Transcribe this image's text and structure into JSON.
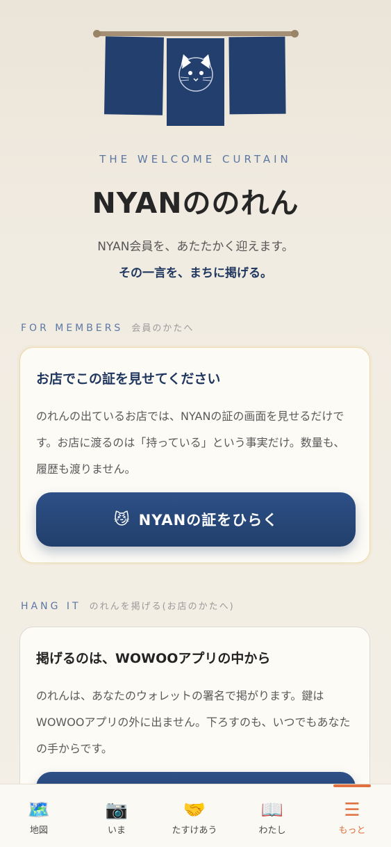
{
  "header": {
    "tagline": "THE WELCOME CURTAIN",
    "title": "NYANののれん",
    "subtitle": "NYAN会員を、あたたかく迎えます。",
    "subtitle_emphasis": "その一言を、まちに掲げる。"
  },
  "members_section": {
    "label_en": "FOR MEMBERS",
    "label_jp": "会員のかたへ",
    "card_title": "お店でこの証を見せてください",
    "card_body": "のれんの出ているお店では、NYANの証の画面を見せるだけです。お店に渡るのは「持っている」という事実だけ。数量も、履歴も渡りません。",
    "button_icon": "😼",
    "button_label": "NYANの証をひらく"
  },
  "hang_section": {
    "label_en": "HANG IT",
    "label_jp": "のれんを掲げる(お店のかたへ)",
    "card_title": "掲げるのは、WOWOOアプリの中から",
    "card_body": "のれんは、あなたのウォレットの署名で掲がります。鍵はWOWOOアプリの外に出ません。下ろすのも、いつでもあなたの手からです。"
  },
  "tabbar": {
    "items": [
      {
        "icon": "🗺️",
        "icon_name": "map-icon",
        "label": "地図"
      },
      {
        "icon": "📷",
        "icon_name": "camera-icon",
        "label": "いま"
      },
      {
        "icon": "🤝",
        "icon_name": "handshake-icon",
        "label": "たすけあう"
      },
      {
        "icon": "📖",
        "icon_name": "book-icon",
        "label": "わたし"
      },
      {
        "icon": "☰",
        "icon_name": "menu-icon",
        "label": "もっと"
      }
    ],
    "active_index": 4
  },
  "colors": {
    "navy": "#233f6d",
    "accent_orange": "#e0703f",
    "background": "#f1ece2"
  }
}
